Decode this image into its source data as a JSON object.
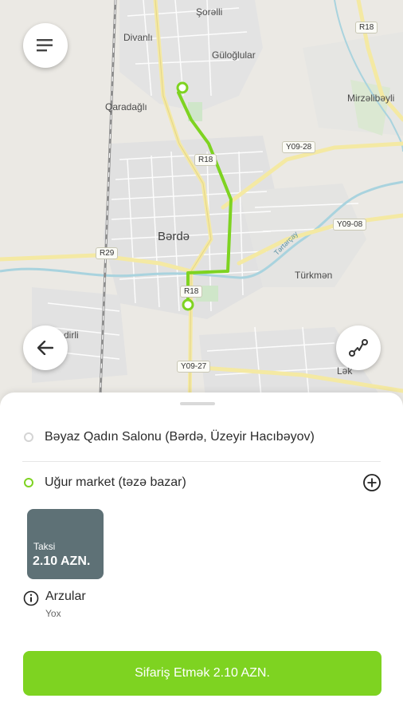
{
  "map": {
    "labels": {
      "serelli": "Şorəlli",
      "divanli": "Divanlı",
      "guloglular": "Güloğlular",
      "mirzalibayli": "Mirzəlibəyli",
      "qaradagli": "Qaradağlı",
      "barda": "Bərdə",
      "turkmen": "Türkmən",
      "lak": "Lək",
      "dirli": "dirli",
      "river": "Tərtərçay"
    },
    "road_tags": {
      "r18_top": "R18",
      "r18_mid": "R18",
      "r18_low": "R18",
      "y09_28": "Y09-28",
      "y09_08": "Y09-08",
      "r29": "R29",
      "y09_27": "Y09-27"
    },
    "route_color": "#7ed321"
  },
  "controls": {
    "menu_icon": "menu-icon",
    "back_icon": "arrow-left-icon",
    "route_icon": "route-icon"
  },
  "trip": {
    "origin": "Bəyaz Qadın Salonu (Bərdə, Üzeyir Hacıbəyov)",
    "destination": "Uğur market (təzə bazar)",
    "add_stop_icon": "add-circle-icon"
  },
  "tariff": {
    "name": "Taksi",
    "price": "2.10 AZN.",
    "card_color": "#5e7176"
  },
  "wishes": {
    "label": "Arzular",
    "value": "Yox",
    "icon": "info-icon"
  },
  "order_button": {
    "label": "Sifariş Etmək 2.10 AZN.",
    "color": "#7ed321"
  }
}
